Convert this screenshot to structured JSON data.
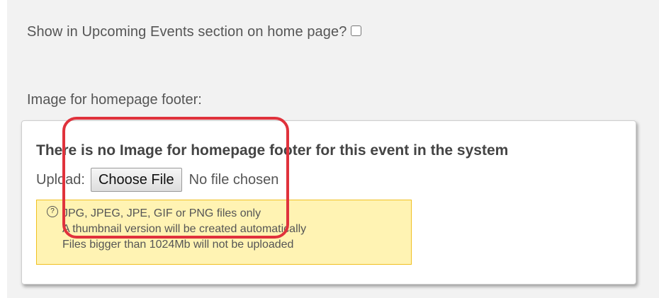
{
  "form": {
    "show_upcoming_label": "Show in Upcoming Events section on home page?",
    "image_label": "Image for homepage footer:"
  },
  "upload": {
    "no_image_message": "There is no Image for homepage footer for this event in the system",
    "upload_label": "Upload:",
    "choose_file_label": "Choose File",
    "file_status": "No file chosen"
  },
  "notes": {
    "help_glyph": "?",
    "lines": [
      "JPG, JPEG, JPE, GIF or PNG files only",
      "A thumbnail version will be created automatically",
      "Files bigger than 1024Mb will not be uploaded"
    ]
  },
  "colors": {
    "highlight": "#e0323c",
    "note_bg": "#fff3b3",
    "note_border": "#f0c020"
  }
}
